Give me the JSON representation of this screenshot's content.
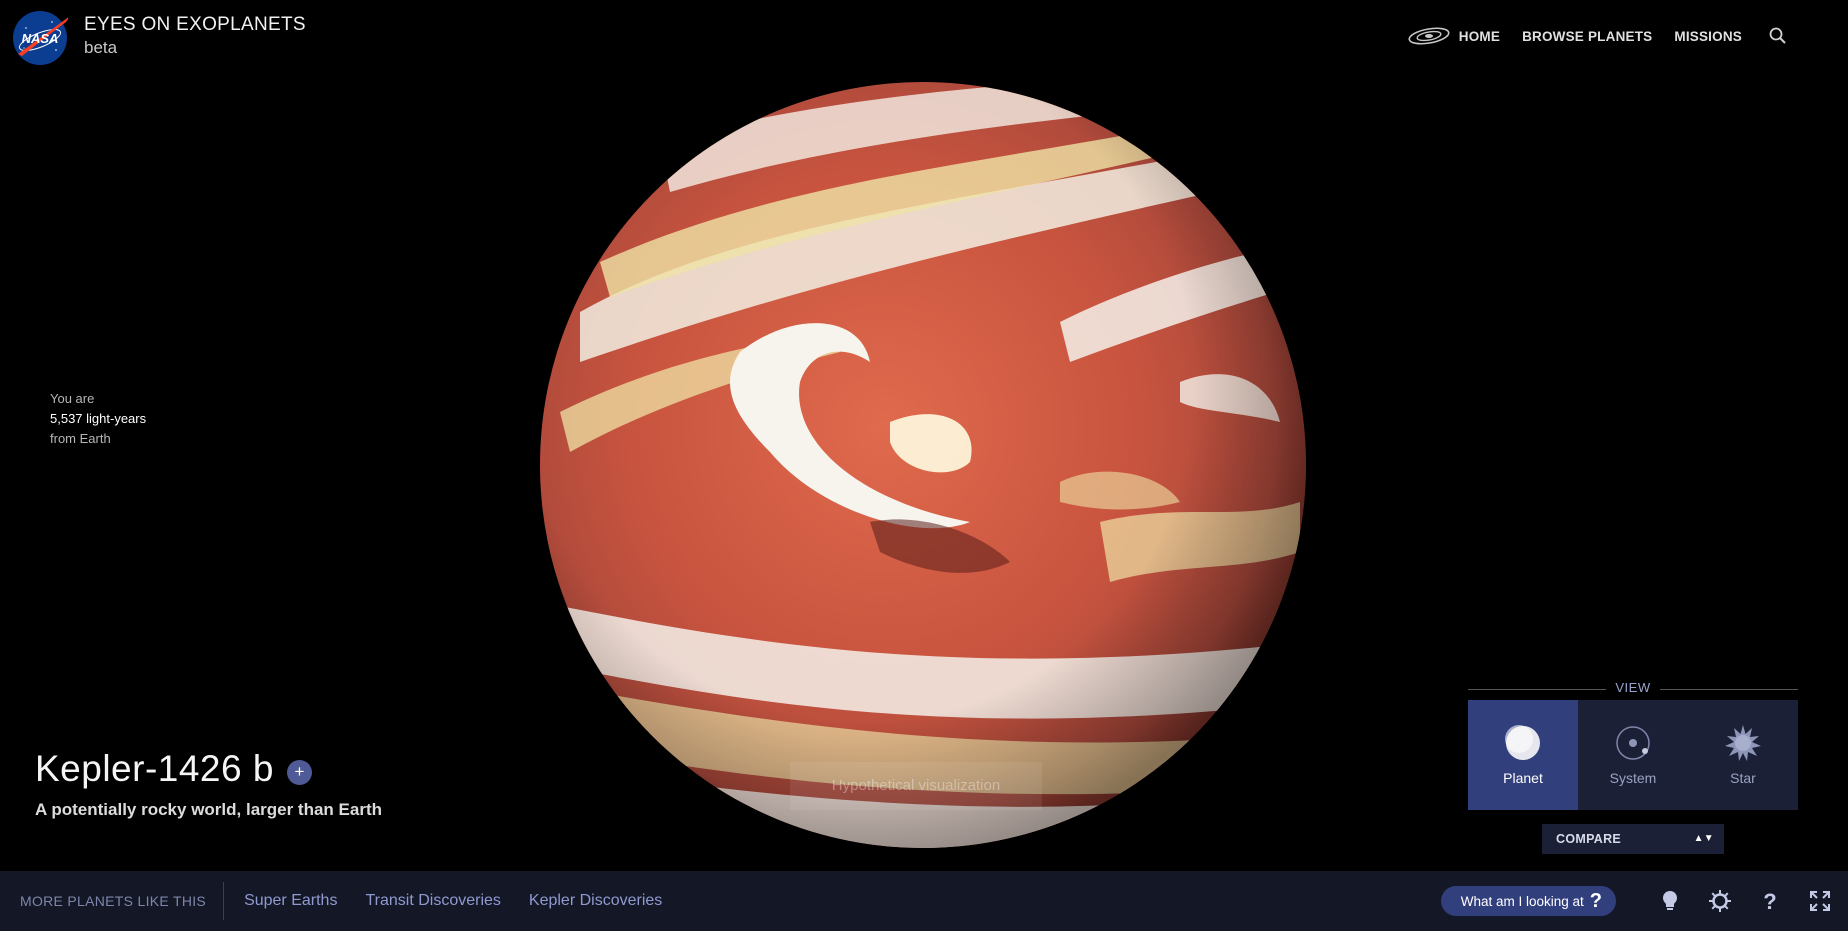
{
  "header": {
    "title": "EYES ON EXOPLANETS",
    "subtitle": "beta",
    "logo_text": "NASA",
    "nav": {
      "home": "HOME",
      "browse": "BROWSE PLANETS",
      "missions": "MISSIONS"
    }
  },
  "distance": {
    "prefix": "You are",
    "value": "5,537 light-years",
    "suffix": "from Earth"
  },
  "planet": {
    "name": "Kepler-1426 b",
    "add_label": "+",
    "description": "A potentially rocky world, larger than Earth",
    "visualization_note": "Hypothetical visualization"
  },
  "view_panel": {
    "label": "VIEW",
    "options": [
      {
        "label": "Planet",
        "icon": "planet-icon",
        "active": true
      },
      {
        "label": "System",
        "icon": "system-icon",
        "active": false
      },
      {
        "label": "Star",
        "icon": "star-icon",
        "active": false
      }
    ],
    "compare": "COMPARE"
  },
  "bottom_bar": {
    "more_label": "MORE PLANETS LIKE THIS",
    "links": [
      "Super Earths",
      "Transit Discoveries",
      "Kepler Discoveries"
    ],
    "what_button": "What am I looking at",
    "what_q": "?",
    "icons": [
      "lightbulb-icon",
      "settings-gear-icon",
      "help-icon",
      "fullscreen-icon"
    ]
  },
  "colors": {
    "accent": "#323f7d",
    "bottom_bar_bg": "#131726",
    "link": "#8f9ad0"
  }
}
